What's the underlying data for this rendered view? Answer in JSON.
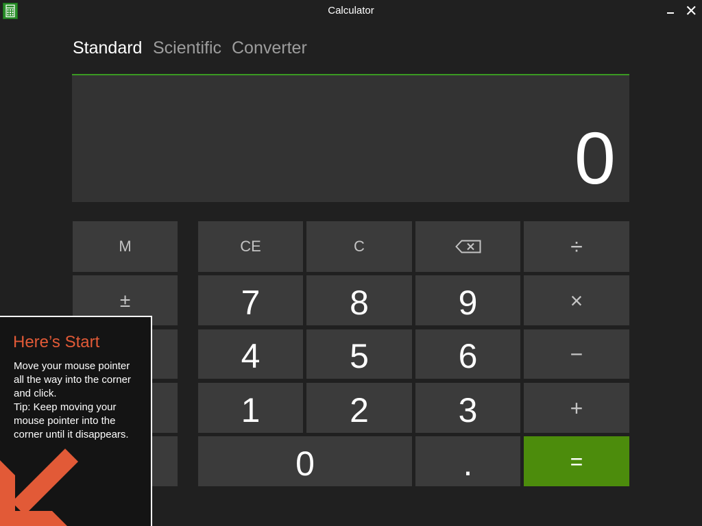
{
  "window": {
    "title": "Calculator",
    "app_icon": "calculator-app-icon",
    "minimize_icon": "minimize-icon",
    "close_icon": "close-icon"
  },
  "tabs": [
    {
      "label": "Standard",
      "selected": true
    },
    {
      "label": "Scientific",
      "selected": false
    },
    {
      "label": "Converter",
      "selected": false
    }
  ],
  "display": {
    "value": "0"
  },
  "keypad": {
    "left_column": [
      {
        "label": "M"
      },
      {
        "label": "±"
      }
    ],
    "rows": [
      [
        {
          "label": "CE"
        },
        {
          "label": "C"
        },
        {
          "icon": "backspace-icon"
        },
        {
          "label": "÷"
        }
      ],
      [
        {
          "label": "7"
        },
        {
          "label": "8"
        },
        {
          "label": "9"
        },
        {
          "label": "×"
        }
      ],
      [
        {
          "label": "4"
        },
        {
          "label": "5"
        },
        {
          "label": "6"
        },
        {
          "label": "−"
        }
      ],
      [
        {
          "label": "1"
        },
        {
          "label": "2"
        },
        {
          "label": "3"
        },
        {
          "label": "+"
        }
      ],
      [
        {
          "label": "0"
        },
        {
          "label": "."
        },
        {
          "label": "="
        }
      ]
    ]
  },
  "start_tip": {
    "title": "Here’s Start",
    "paragraphs": [
      "Move your mouse pointer all the way into the corner and click.",
      "Tip: Keep moving your mouse pointer into the corner until it disappears."
    ],
    "arrow_icon": "arrow-down-left-icon"
  },
  "colors": {
    "background": "#202020",
    "display": "#333333",
    "key": "#3b3b3b",
    "accent_green": "#4c8c0c",
    "display_top_border": "#3a9a22",
    "tip_accent": "#e25a37",
    "tip_background": "#141414",
    "text_primary": "#ffffff",
    "text_secondary": "#9d9d9d"
  }
}
